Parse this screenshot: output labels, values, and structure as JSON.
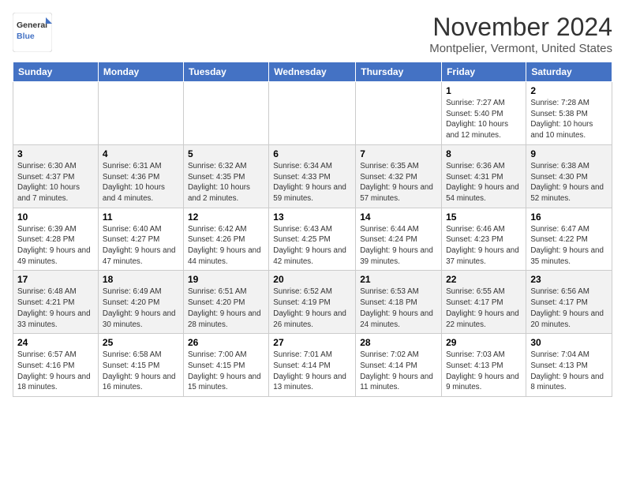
{
  "logo": {
    "text_general": "General",
    "text_blue": "Blue"
  },
  "title": "November 2024",
  "location": "Montpelier, Vermont, United States",
  "days_of_week": [
    "Sunday",
    "Monday",
    "Tuesday",
    "Wednesday",
    "Thursday",
    "Friday",
    "Saturday"
  ],
  "weeks": [
    [
      {
        "day": "",
        "info": ""
      },
      {
        "day": "",
        "info": ""
      },
      {
        "day": "",
        "info": ""
      },
      {
        "day": "",
        "info": ""
      },
      {
        "day": "",
        "info": ""
      },
      {
        "day": "1",
        "info": "Sunrise: 7:27 AM\nSunset: 5:40 PM\nDaylight: 10 hours and 12 minutes."
      },
      {
        "day": "2",
        "info": "Sunrise: 7:28 AM\nSunset: 5:38 PM\nDaylight: 10 hours and 10 minutes."
      }
    ],
    [
      {
        "day": "3",
        "info": "Sunrise: 6:30 AM\nSunset: 4:37 PM\nDaylight: 10 hours and 7 minutes."
      },
      {
        "day": "4",
        "info": "Sunrise: 6:31 AM\nSunset: 4:36 PM\nDaylight: 10 hours and 4 minutes."
      },
      {
        "day": "5",
        "info": "Sunrise: 6:32 AM\nSunset: 4:35 PM\nDaylight: 10 hours and 2 minutes."
      },
      {
        "day": "6",
        "info": "Sunrise: 6:34 AM\nSunset: 4:33 PM\nDaylight: 9 hours and 59 minutes."
      },
      {
        "day": "7",
        "info": "Sunrise: 6:35 AM\nSunset: 4:32 PM\nDaylight: 9 hours and 57 minutes."
      },
      {
        "day": "8",
        "info": "Sunrise: 6:36 AM\nSunset: 4:31 PM\nDaylight: 9 hours and 54 minutes."
      },
      {
        "day": "9",
        "info": "Sunrise: 6:38 AM\nSunset: 4:30 PM\nDaylight: 9 hours and 52 minutes."
      }
    ],
    [
      {
        "day": "10",
        "info": "Sunrise: 6:39 AM\nSunset: 4:28 PM\nDaylight: 9 hours and 49 minutes."
      },
      {
        "day": "11",
        "info": "Sunrise: 6:40 AM\nSunset: 4:27 PM\nDaylight: 9 hours and 47 minutes."
      },
      {
        "day": "12",
        "info": "Sunrise: 6:42 AM\nSunset: 4:26 PM\nDaylight: 9 hours and 44 minutes."
      },
      {
        "day": "13",
        "info": "Sunrise: 6:43 AM\nSunset: 4:25 PM\nDaylight: 9 hours and 42 minutes."
      },
      {
        "day": "14",
        "info": "Sunrise: 6:44 AM\nSunset: 4:24 PM\nDaylight: 9 hours and 39 minutes."
      },
      {
        "day": "15",
        "info": "Sunrise: 6:46 AM\nSunset: 4:23 PM\nDaylight: 9 hours and 37 minutes."
      },
      {
        "day": "16",
        "info": "Sunrise: 6:47 AM\nSunset: 4:22 PM\nDaylight: 9 hours and 35 minutes."
      }
    ],
    [
      {
        "day": "17",
        "info": "Sunrise: 6:48 AM\nSunset: 4:21 PM\nDaylight: 9 hours and 33 minutes."
      },
      {
        "day": "18",
        "info": "Sunrise: 6:49 AM\nSunset: 4:20 PM\nDaylight: 9 hours and 30 minutes."
      },
      {
        "day": "19",
        "info": "Sunrise: 6:51 AM\nSunset: 4:20 PM\nDaylight: 9 hours and 28 minutes."
      },
      {
        "day": "20",
        "info": "Sunrise: 6:52 AM\nSunset: 4:19 PM\nDaylight: 9 hours and 26 minutes."
      },
      {
        "day": "21",
        "info": "Sunrise: 6:53 AM\nSunset: 4:18 PM\nDaylight: 9 hours and 24 minutes."
      },
      {
        "day": "22",
        "info": "Sunrise: 6:55 AM\nSunset: 4:17 PM\nDaylight: 9 hours and 22 minutes."
      },
      {
        "day": "23",
        "info": "Sunrise: 6:56 AM\nSunset: 4:17 PM\nDaylight: 9 hours and 20 minutes."
      }
    ],
    [
      {
        "day": "24",
        "info": "Sunrise: 6:57 AM\nSunset: 4:16 PM\nDaylight: 9 hours and 18 minutes."
      },
      {
        "day": "25",
        "info": "Sunrise: 6:58 AM\nSunset: 4:15 PM\nDaylight: 9 hours and 16 minutes."
      },
      {
        "day": "26",
        "info": "Sunrise: 7:00 AM\nSunset: 4:15 PM\nDaylight: 9 hours and 15 minutes."
      },
      {
        "day": "27",
        "info": "Sunrise: 7:01 AM\nSunset: 4:14 PM\nDaylight: 9 hours and 13 minutes."
      },
      {
        "day": "28",
        "info": "Sunrise: 7:02 AM\nSunset: 4:14 PM\nDaylight: 9 hours and 11 minutes."
      },
      {
        "day": "29",
        "info": "Sunrise: 7:03 AM\nSunset: 4:13 PM\nDaylight: 9 hours and 9 minutes."
      },
      {
        "day": "30",
        "info": "Sunrise: 7:04 AM\nSunset: 4:13 PM\nDaylight: 9 hours and 8 minutes."
      }
    ]
  ]
}
